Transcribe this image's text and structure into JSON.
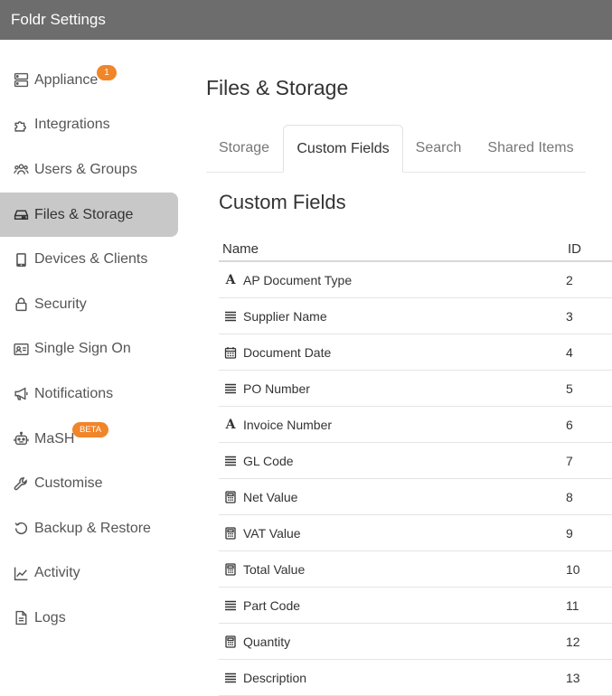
{
  "window": {
    "title": "Foldr Settings"
  },
  "sidebar": {
    "items": [
      {
        "label": "Appliance",
        "icon": "server-icon",
        "badge": "1"
      },
      {
        "label": "Integrations",
        "icon": "puzzle-icon"
      },
      {
        "label": "Users & Groups",
        "icon": "users-icon"
      },
      {
        "label": "Files & Storage",
        "icon": "hdd-icon",
        "active": true
      },
      {
        "label": "Devices & Clients",
        "icon": "tablet-icon"
      },
      {
        "label": "Security",
        "icon": "lock-icon"
      },
      {
        "label": "Single Sign On",
        "icon": "id-card-icon"
      },
      {
        "label": "Notifications",
        "icon": "megaphone-icon"
      },
      {
        "label": "MaSH",
        "icon": "robot-icon",
        "badge": "BETA"
      },
      {
        "label": "Customise",
        "icon": "wrench-icon"
      },
      {
        "label": "Backup & Restore",
        "icon": "history-icon"
      },
      {
        "label": "Activity",
        "icon": "chart-line-icon"
      },
      {
        "label": "Logs",
        "icon": "file-icon"
      }
    ]
  },
  "main": {
    "title": "Files & Storage",
    "tabs": [
      {
        "label": "Storage"
      },
      {
        "label": "Custom Fields",
        "active": true
      },
      {
        "label": "Search"
      },
      {
        "label": "Shared Items"
      }
    ],
    "section_title": "Custom Fields",
    "table": {
      "columns": [
        "Name",
        "ID"
      ],
      "rows": [
        {
          "icon": "text-icon",
          "name": "AP Document Type",
          "id": "2"
        },
        {
          "icon": "lines-icon",
          "name": "Supplier Name",
          "id": "3"
        },
        {
          "icon": "calendar-icon",
          "name": "Document Date",
          "id": "4"
        },
        {
          "icon": "lines-icon",
          "name": "PO Number",
          "id": "5"
        },
        {
          "icon": "text-icon",
          "name": "Invoice Number",
          "id": "6"
        },
        {
          "icon": "lines-icon",
          "name": "GL Code",
          "id": "7"
        },
        {
          "icon": "calculator-icon",
          "name": "Net Value",
          "id": "8"
        },
        {
          "icon": "calculator-icon",
          "name": "VAT Value",
          "id": "9"
        },
        {
          "icon": "calculator-icon",
          "name": "Total Value",
          "id": "10"
        },
        {
          "icon": "lines-icon",
          "name": "Part Code",
          "id": "11"
        },
        {
          "icon": "calculator-icon",
          "name": "Quantity",
          "id": "12"
        },
        {
          "icon": "lines-icon",
          "name": "Description",
          "id": "13"
        }
      ]
    }
  },
  "colors": {
    "titlebar": "#6d6d6d",
    "active_nav": "#c8c8c8",
    "badge": "#f0852a"
  }
}
